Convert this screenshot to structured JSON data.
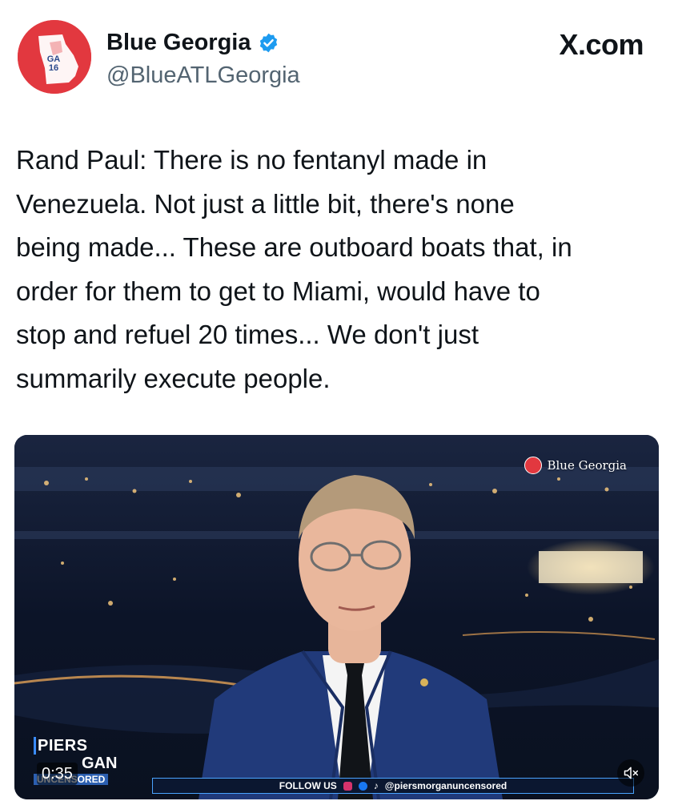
{
  "account": {
    "display_name": "Blue Georgia",
    "handle": "@BlueATLGeorgia",
    "avatar_text_1": "GA",
    "avatar_text_2": "16"
  },
  "site_label": "X.com",
  "tweet": {
    "lines": [
      "Rand Paul: There is no fentanyl made in",
      "Venezuela. Not just a little bit, there's none",
      "being made... These are outboard boats that, in",
      "order for them to get to Miami, would have to",
      "stop and refuel 20 times... We don't just",
      "summarily execute people."
    ]
  },
  "video": {
    "watermark": "Blue Georgia",
    "show_logo_line1": "PIERS",
    "show_logo_line2": "GAN",
    "show_logo_line3": "UNCENSORED",
    "timestamp": "0:35",
    "ticker_follow": "FOLLOW US",
    "ticker_handle": "@piersmorganuncensored",
    "mute_icon": "speaker-muted-icon"
  },
  "colors": {
    "brand_red": "#e2383f",
    "verified_blue": "#1d9bf0",
    "handle_gray": "#536471",
    "text": "#0f1419"
  }
}
